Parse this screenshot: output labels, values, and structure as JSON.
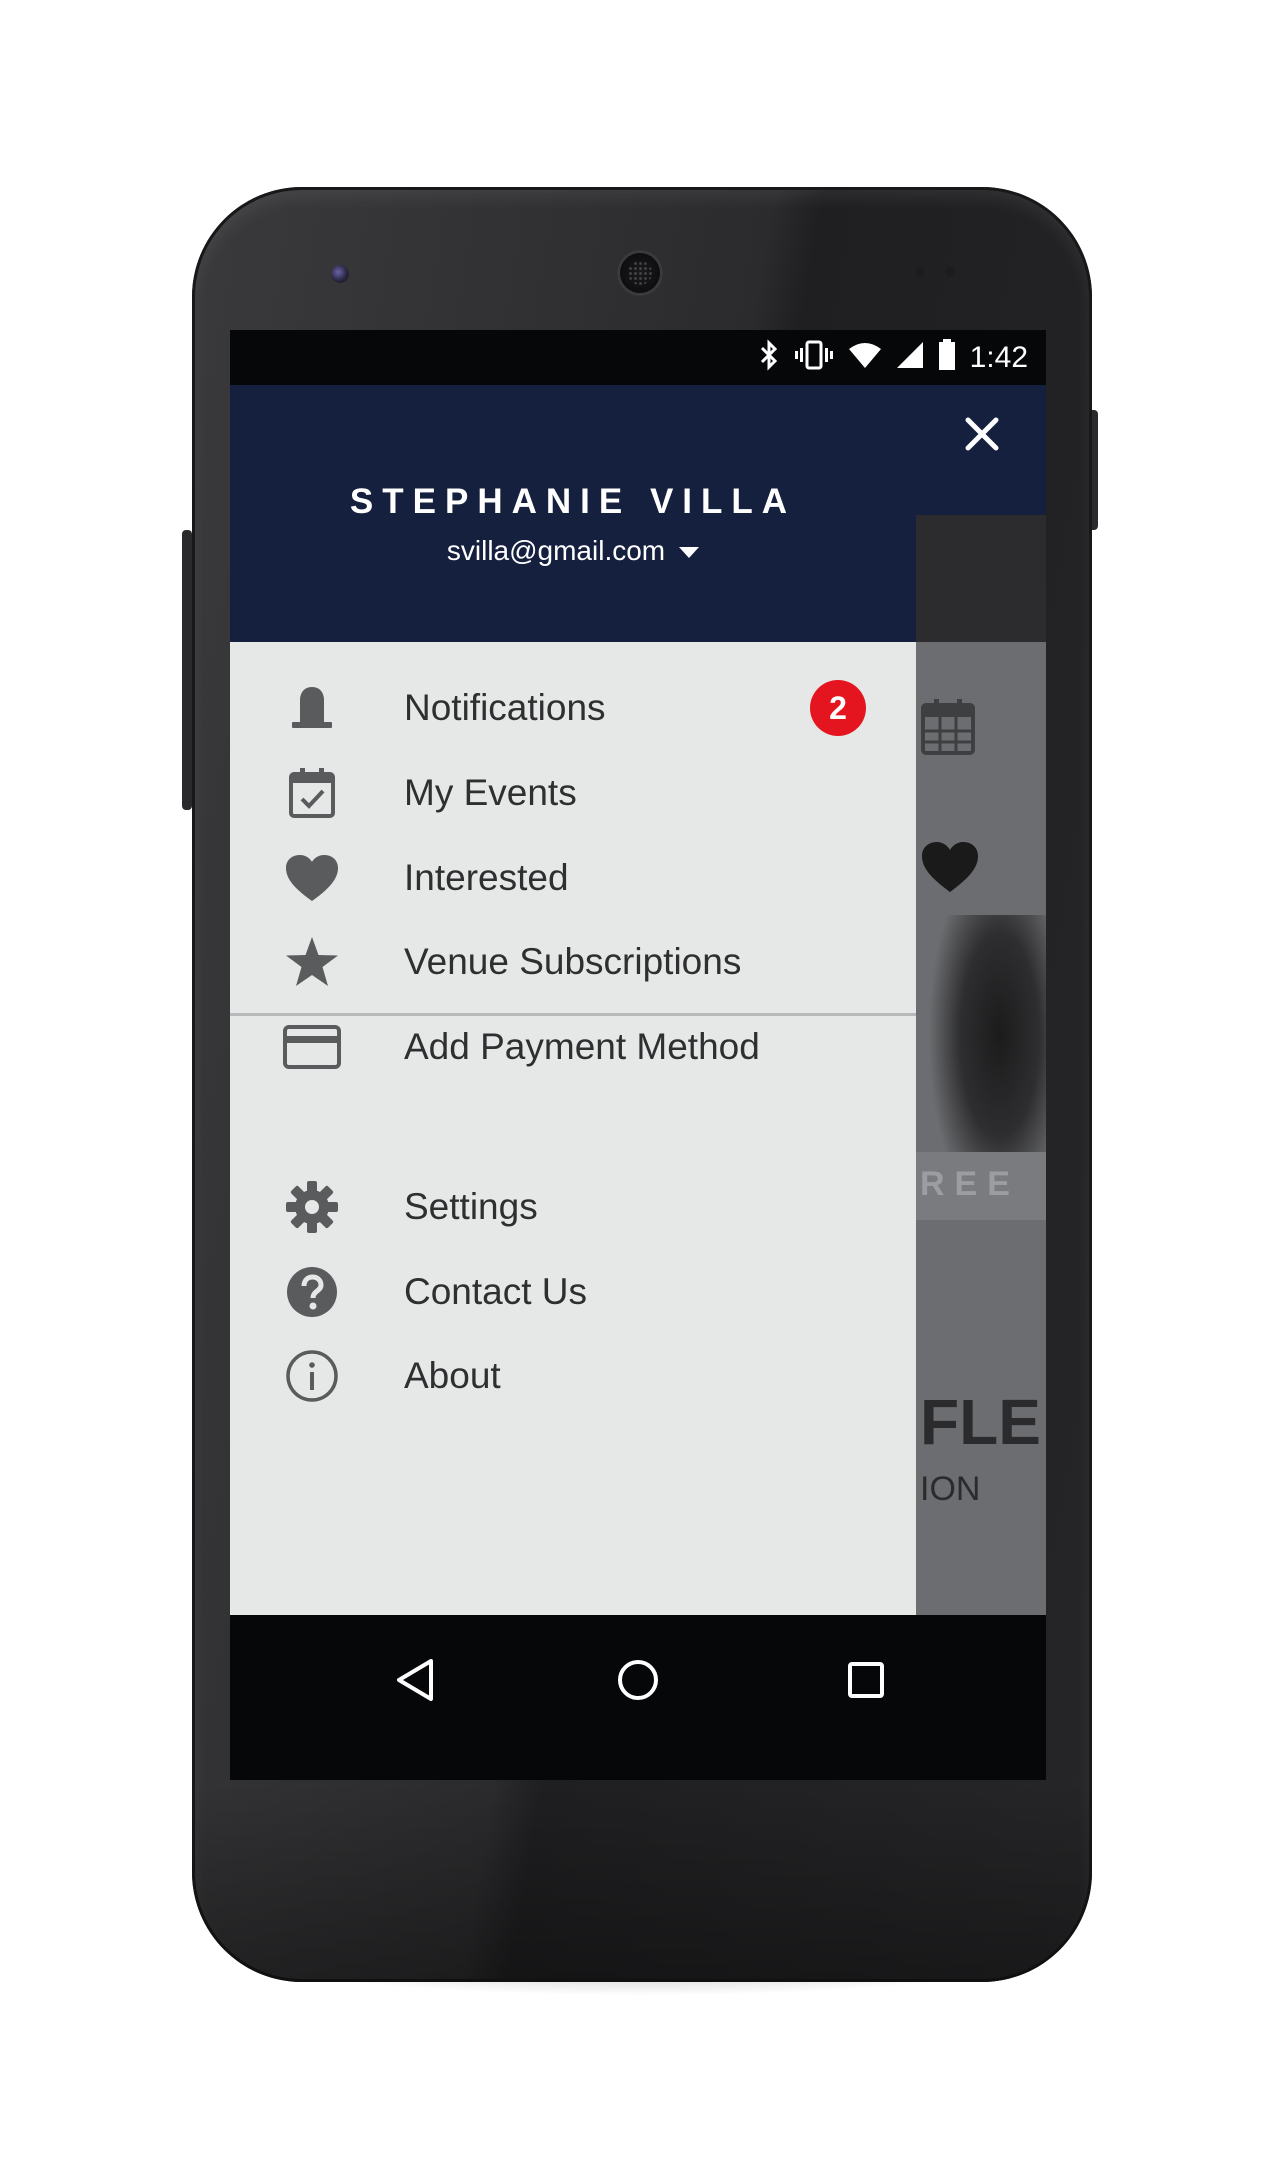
{
  "status_bar": {
    "time": "1:42",
    "icons": [
      "bluetooth-icon",
      "vibrate-icon",
      "wifi-icon",
      "cellular-signal-icon",
      "battery-icon"
    ]
  },
  "drawer": {
    "user_name": "STEPHANIE VILLA",
    "email": "svilla@gmail.com",
    "primary_items": [
      {
        "label": "Notifications",
        "icon": "bell-icon",
        "badge": "2"
      },
      {
        "label": "My Events",
        "icon": "calendar-check-icon"
      },
      {
        "label": "Interested",
        "icon": "heart-icon"
      },
      {
        "label": "Venue Subscriptions",
        "icon": "star-icon"
      },
      {
        "label": "Add Payment Method",
        "icon": "credit-card-icon"
      }
    ],
    "secondary_items": [
      {
        "label": "Settings",
        "icon": "gear-icon"
      },
      {
        "label": "Contact Us",
        "icon": "help-icon"
      },
      {
        "label": "About",
        "icon": "info-icon"
      }
    ]
  },
  "background_app": {
    "band_text": "REE",
    "logo_text": "FLE",
    "sub_text": "ION"
  },
  "colors": {
    "header_navy": "#15203e",
    "drawer_bg": "#e6e7e7",
    "badge_red": "#e4151f",
    "icon_grey": "#5a5b5d",
    "text_dark": "#2f2f31"
  },
  "nav_bar": {
    "buttons": [
      "back-icon",
      "home-icon",
      "recents-icon"
    ]
  }
}
